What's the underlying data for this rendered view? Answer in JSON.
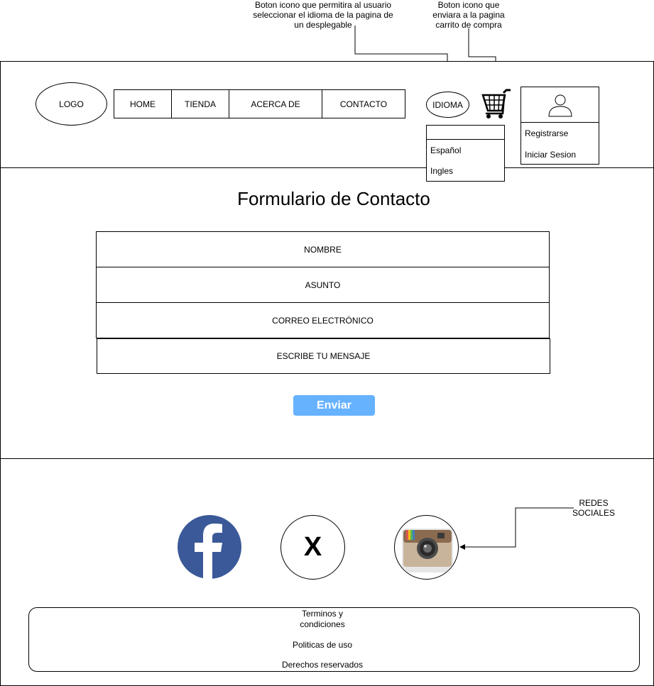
{
  "annotations": {
    "language": "Boton icono que permitira al usuario seleccionar el idioma de la pagina de un desplegable",
    "cart": "Boton icono que enviara a la pagina carrito de compra",
    "social": "REDES SOCIALES"
  },
  "header": {
    "logo": "LOGO",
    "nav": [
      "HOME",
      "TIENDA",
      "ACERCA DE",
      "CONTACTO"
    ],
    "language_button": "IDIOMA",
    "language_options": [
      "Español",
      "Ingles"
    ],
    "account_menu": [
      "Registrarse",
      "Iniciar Sesion"
    ]
  },
  "form": {
    "title": "Formulario de Contacto",
    "fields": [
      "NOMBRE",
      "ASUNTO",
      "CORREO ELECTRÓNICO",
      "ESCRIBE TU MENSAJE"
    ],
    "submit": "Enviar"
  },
  "footer": {
    "social": [
      "facebook",
      "x",
      "instagram"
    ],
    "x_label": "X",
    "links": [
      "Terminos y condiciones",
      "Politicas de uso",
      "Derechos reservados"
    ]
  },
  "colors": {
    "submit_button": "#66b2ff",
    "facebook": "#3b5998"
  }
}
